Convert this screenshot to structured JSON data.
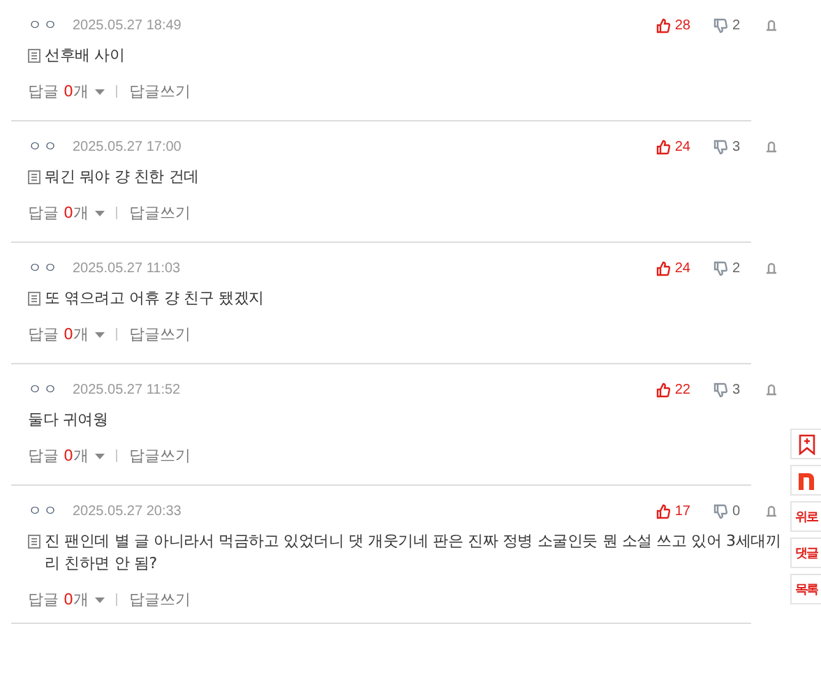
{
  "comments": [
    {
      "author": "ㅇㅇ",
      "date": "2025.05.27 18:49",
      "likes": "28",
      "dislikes": "2",
      "icon": true,
      "text": "선후배 사이",
      "reply_label": "답글",
      "reply_count": "0",
      "reply_unit": "개",
      "write_reply": "답글쓰기"
    },
    {
      "author": "ㅇㅇ",
      "date": "2025.05.27 17:00",
      "likes": "24",
      "dislikes": "3",
      "icon": true,
      "text": "뭐긴 뭐야 걍 친한 건데",
      "reply_label": "답글",
      "reply_count": "0",
      "reply_unit": "개",
      "write_reply": "답글쓰기"
    },
    {
      "author": "ㅇㅇ",
      "date": "2025.05.27 11:03",
      "likes": "24",
      "dislikes": "2",
      "icon": true,
      "text": "또 엮으려고 어휴 걍 친구 됐겠지",
      "reply_label": "답글",
      "reply_count": "0",
      "reply_unit": "개",
      "write_reply": "답글쓰기"
    },
    {
      "author": "ㅇㅇ",
      "date": "2025.05.27 11:52",
      "likes": "22",
      "dislikes": "3",
      "icon": false,
      "text": "둘다 귀여웡",
      "reply_label": "답글",
      "reply_count": "0",
      "reply_unit": "개",
      "write_reply": "답글쓰기"
    },
    {
      "author": "ㅇㅇ",
      "date": "2025.05.27 20:33",
      "likes": "17",
      "dislikes": "0",
      "icon": true,
      "text": "진 팬인데 별 글 아니라서 먹금하고 있었더니 댓 개웃기네 판은 진짜 정병 소굴인듯 뭔 소설 쓰고 있어 3세대끼리 친하면 안 됨?",
      "reply_label": "답글",
      "reply_count": "0",
      "reply_unit": "개",
      "write_reply": "답글쓰기"
    }
  ],
  "side_buttons": [
    {
      "kind": "bookmark"
    },
    {
      "kind": "logo"
    },
    {
      "kind": "text",
      "label": "위로"
    },
    {
      "kind": "text",
      "label": "댓글"
    },
    {
      "kind": "text",
      "label": "목록"
    }
  ]
}
